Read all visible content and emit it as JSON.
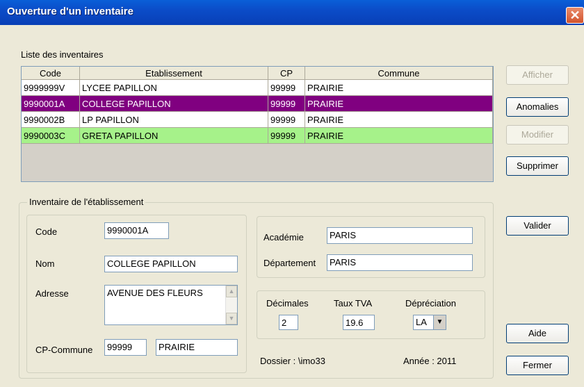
{
  "window": {
    "title": "Ouverture d'un inventaire",
    "close_glyph": "✕"
  },
  "list": {
    "label": "Liste des inventaires",
    "columns": [
      "Code",
      "Etablissement",
      "CP",
      "Commune"
    ],
    "rows": [
      {
        "code": "9999999V",
        "etablissement": "LYCEE PAPILLON",
        "cp": "99999",
        "commune": "PRAIRIE",
        "bg": "#ffffff",
        "fg": "#000000"
      },
      {
        "code": "9990001A",
        "etablissement": "COLLEGE PAPILLON",
        "cp": "99999",
        "commune": "PRAIRIE",
        "bg": "#800080",
        "fg": "#ffffff"
      },
      {
        "code": "9990002B",
        "etablissement": "LP PAPILLON",
        "cp": "99999",
        "commune": "PRAIRIE",
        "bg": "#ffffff",
        "fg": "#000000"
      },
      {
        "code": "9990003C",
        "etablissement": "GRETA PAPILLON",
        "cp": "99999",
        "commune": "PRAIRIE",
        "bg": "#a6f28a",
        "fg": "#000000"
      }
    ]
  },
  "buttons": {
    "afficher": "Afficher",
    "anomalies": "Anomalies",
    "modifier": "Modifier",
    "supprimer": "Supprimer",
    "valider": "Valider",
    "aide": "Aide",
    "fermer": "Fermer"
  },
  "form": {
    "group_label": "Inventaire de l'établissement",
    "code_label": "Code",
    "code_value": "9990001A",
    "nom_label": "Nom",
    "nom_value": "COLLEGE PAPILLON",
    "adresse_label": "Adresse",
    "adresse_value": "AVENUE DES FLEURS",
    "cp_commune_label": "CP-Commune",
    "cp_value": "99999",
    "commune_value": "PRAIRIE",
    "academie_label": "Académie",
    "academie_value": "PARIS",
    "departement_label": "Département",
    "departement_value": "PARIS",
    "decimales_label": "Décimales",
    "decimales_value": "2",
    "taux_tva_label": "Taux TVA",
    "taux_tva_value": "19.6",
    "depreciation_label": "Dépréciation",
    "depreciation_value": "LA",
    "dossier_text": "Dossier : \\imo33",
    "annee_text": "Année : 2011"
  }
}
